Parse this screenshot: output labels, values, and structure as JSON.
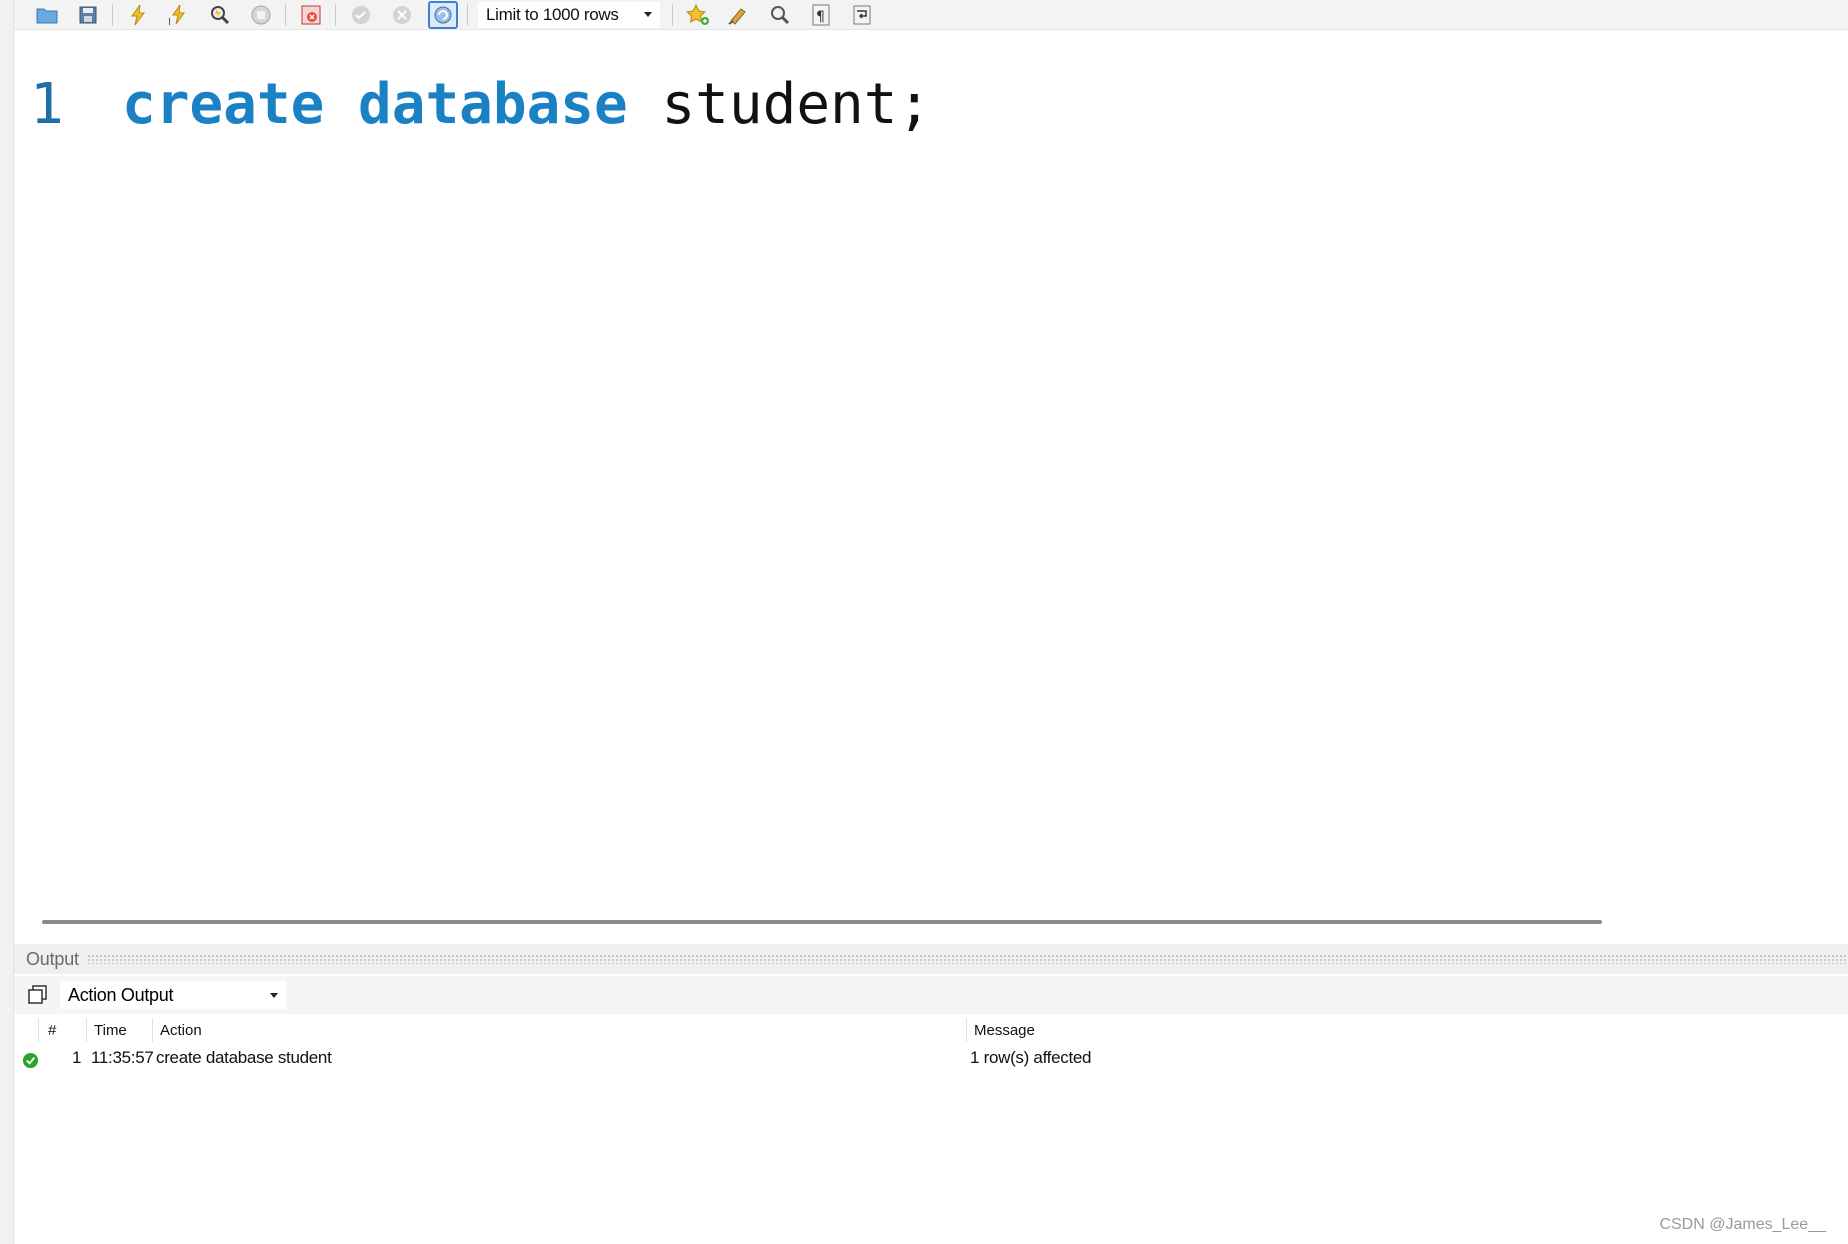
{
  "toolbar": {
    "icons": [
      "open-file-icon",
      "save-icon",
      "execute-icon",
      "execute-current-icon",
      "explain-icon",
      "stop-icon",
      "toggle-error-icon",
      "commit-icon",
      "rollback-icon",
      "autocommit-icon",
      "add-snippet-icon",
      "beautify-icon",
      "find-icon",
      "invisible-chars-icon",
      "wrap-icon"
    ],
    "limit_label": "Limit to 1000 rows",
    "accent_color": "#3b82d6"
  },
  "editor": {
    "line_number": "1",
    "kw1": "create",
    "kw2": "database",
    "ident": "student",
    "punct": ";",
    "keyword_color": "#1a82c4"
  },
  "output": {
    "title": "Output",
    "selector_value": "Action Output",
    "columns": {
      "num": "#",
      "time": "Time",
      "action": "Action",
      "message": "Message"
    },
    "rows": [
      {
        "status": "success-icon",
        "num": "1",
        "time": "11:35:57",
        "action": "create database student",
        "message": "1 row(s) affected"
      }
    ],
    "success_color": "#2aa52a"
  },
  "watermark": "CSDN @James_Lee__"
}
